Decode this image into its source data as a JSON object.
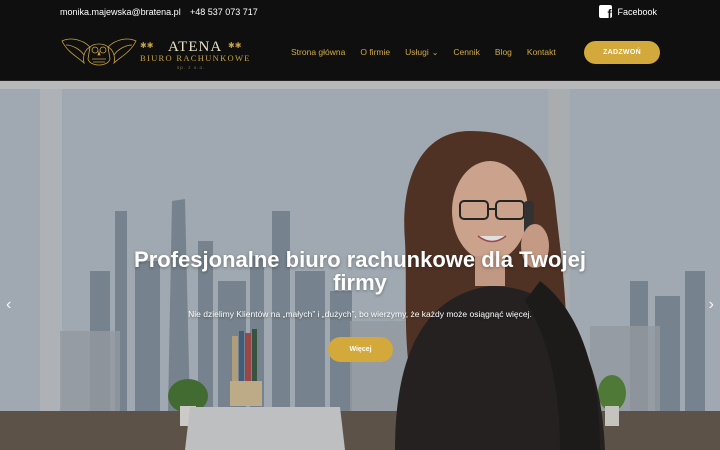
{
  "topbar": {
    "email": "monika.majewska@bratena.pl",
    "phone": "+48 537 073 717",
    "facebook_label": "Facebook",
    "facebook_icon": "facebook-icon"
  },
  "logo": {
    "brand": "ATENA",
    "subtitle": "BIURO RACHUNKOWE",
    "small": "sp. z o.o."
  },
  "nav": {
    "items": [
      {
        "label": "Strona główna"
      },
      {
        "label": "O firmie"
      },
      {
        "label": "Usługi"
      },
      {
        "label": "Cennik"
      },
      {
        "label": "Blog"
      },
      {
        "label": "Kontakt"
      }
    ],
    "call_button": "ZADZWOŃ"
  },
  "hero": {
    "title": "Profesjonalne biuro rachunkowe dla Twojej firmy",
    "subtitle": "Nie dzielimy Klientów na „małych” i „dużych”, bo wierzymy, że każdy może osiągnąć więcej.",
    "button": "Więcej",
    "prev_icon": "chevron-left-icon",
    "next_icon": "chevron-right-icon"
  },
  "colors": {
    "accent": "#d4a93c",
    "header_bg": "#0f0f0f",
    "nav_text": "#d2ab3b"
  }
}
